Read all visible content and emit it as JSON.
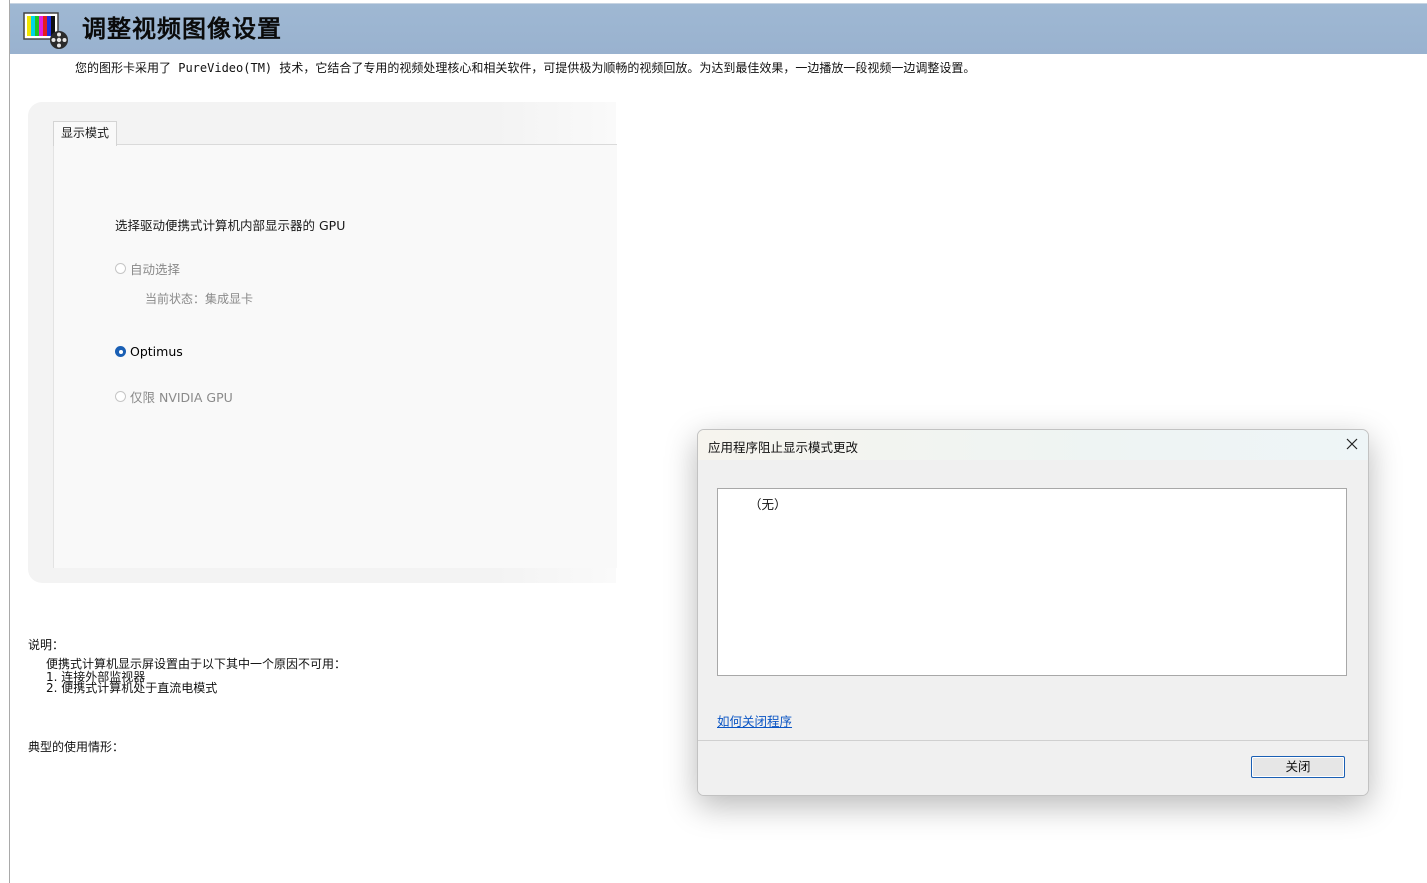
{
  "header": {
    "title": "调整视频图像设置",
    "icon": "video-color-bars-icon"
  },
  "intro_text": "您的图形卡采用了 PureVideo(TM) 技术，它结合了专用的视频处理核心和相关软件，可提供极为顺畅的视频回放。为达到最佳效果，一边播放一段视频一边调整设置。",
  "settings": {
    "tab_label": "显示模式",
    "prompt": "选择驱动便携式计算机内部显示器的 GPU",
    "options": [
      {
        "label": "自动选择",
        "checked": false,
        "enabled": false
      },
      {
        "label": "Optimus",
        "checked": true,
        "enabled": true
      },
      {
        "label": "仅限 NVIDIA GPU",
        "checked": false,
        "enabled": false
      }
    ],
    "current_status": "当前状态：集成显卡"
  },
  "notes": {
    "description_label": "说明：",
    "description_intro": "便携式计算机显示屏设置由于以下其中一个原因不可用：",
    "reasons": [
      "1.  连接外部监视器",
      "2.  便携式计算机处于直流电模式"
    ],
    "typical_usage_label": "典型的使用情形："
  },
  "dialog": {
    "title": "应用程序阻止显示模式更改",
    "list_items": [
      "（无）"
    ],
    "help_link": "如何关闭程序",
    "close_button": "关闭",
    "close_icon": "close-x-icon"
  },
  "colors": {
    "header_bg": "#9fb8d3",
    "accent": "#1a5fb4",
    "link": "#0a55c4"
  }
}
